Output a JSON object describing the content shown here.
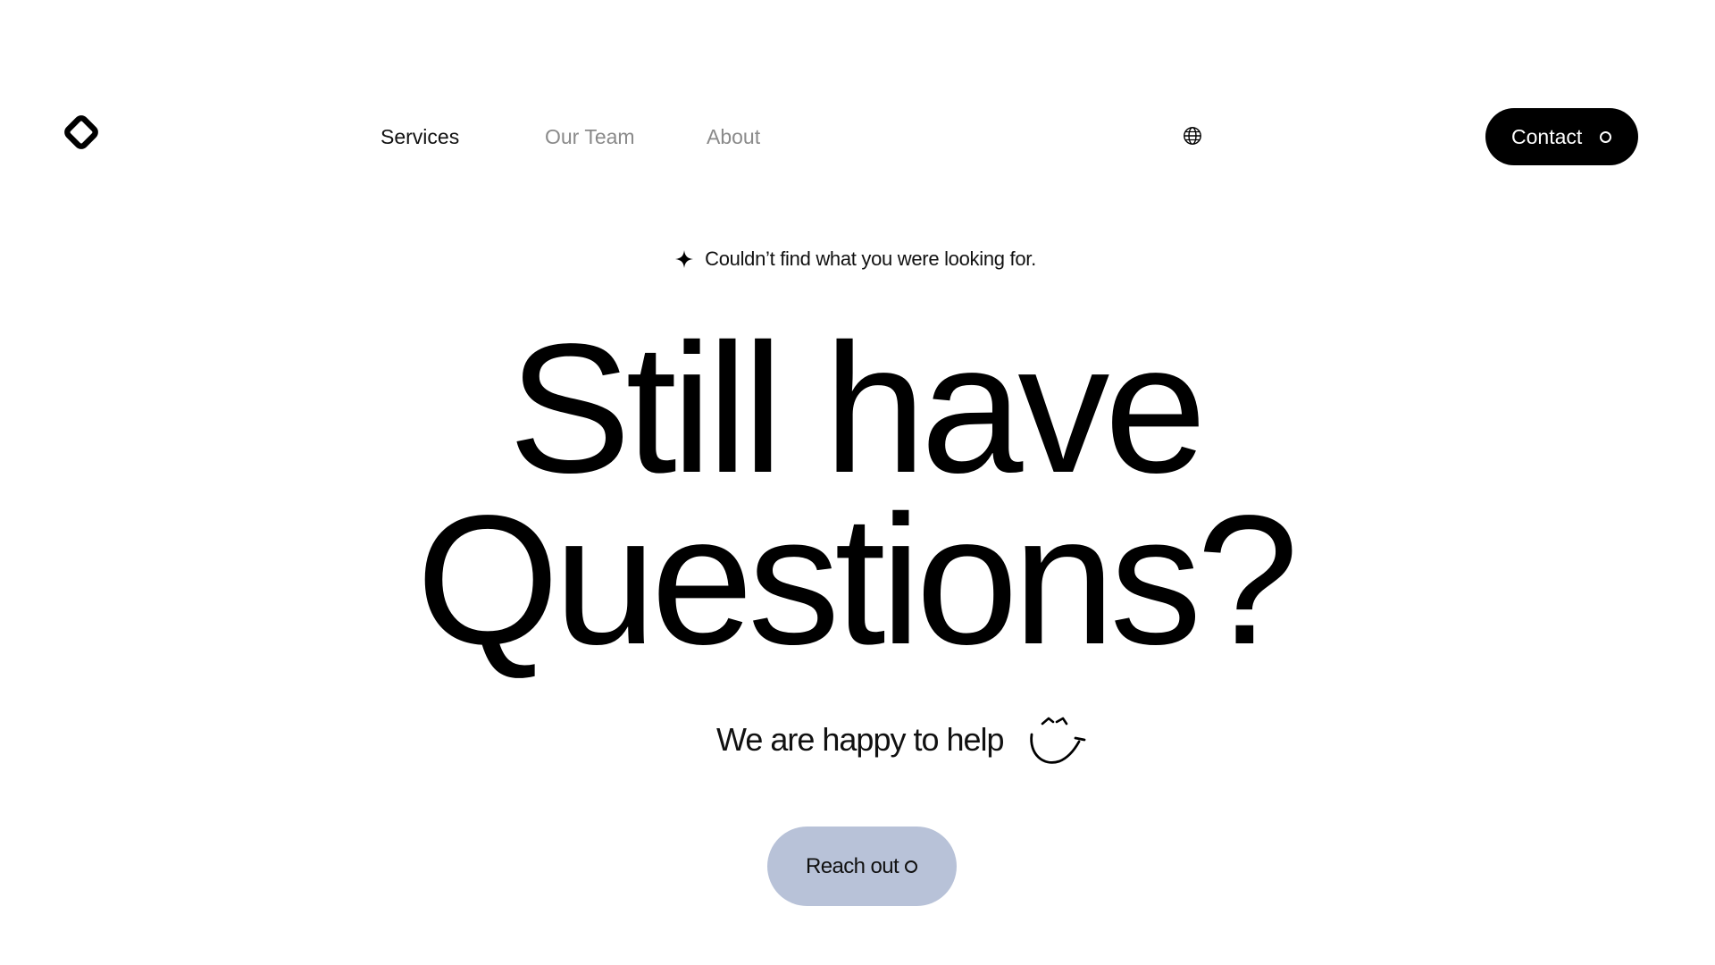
{
  "nav": {
    "logo_icon": "diamond-logo-icon",
    "links": [
      {
        "label": "Services",
        "state": "active"
      },
      {
        "label": "Our Team",
        "state": "muted"
      },
      {
        "label": "About",
        "state": "muted"
      }
    ],
    "language_icon": "globe-icon",
    "contact_label": "Contact"
  },
  "hero": {
    "eyebrow_icon": "sparkle-icon",
    "eyebrow": "Couldn’t find what you were looking for.",
    "headline_line1": "Still have",
    "headline_line2": "Questions?",
    "subline": "We are happy to help",
    "subline_icon": "smiley-face-icon",
    "cta_label": "Reach out"
  },
  "colors": {
    "background": "#ffffff",
    "text": "#000000",
    "muted_nav": "#8a8a8a",
    "contact_button": "#000000",
    "cta_button": "#b8c2d8"
  }
}
